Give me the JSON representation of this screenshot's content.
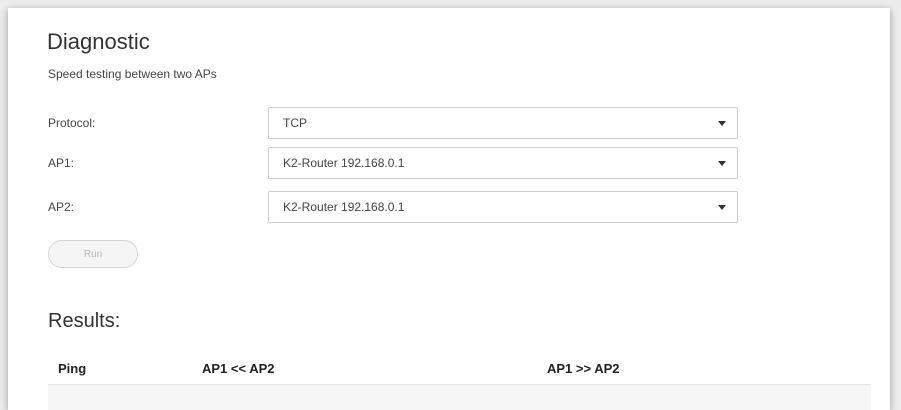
{
  "diagnostic": {
    "title": "Diagnostic",
    "subtitle": "Speed testing between two APs"
  },
  "form": {
    "protocol": {
      "label": "Protocol:",
      "value": "TCP"
    },
    "ap1": {
      "label": "AP1:",
      "value": "K2-Router 192.168.0.1"
    },
    "ap2": {
      "label": "AP2:",
      "value": "K2-Router 192.168.0.1"
    }
  },
  "run_button": {
    "label": "Run",
    "enabled": false
  },
  "results": {
    "title": "Results:",
    "columns": [
      "Ping",
      "AP1 << AP2",
      "AP1 >> AP2"
    ],
    "rows": []
  },
  "icons": {
    "select_caret": "caret-down-icon"
  },
  "colors": {
    "background": "#ececec",
    "card": "#ffffff",
    "text": "#333333",
    "border": "#cfcfcf",
    "disabled_text": "#b8b8b8"
  }
}
